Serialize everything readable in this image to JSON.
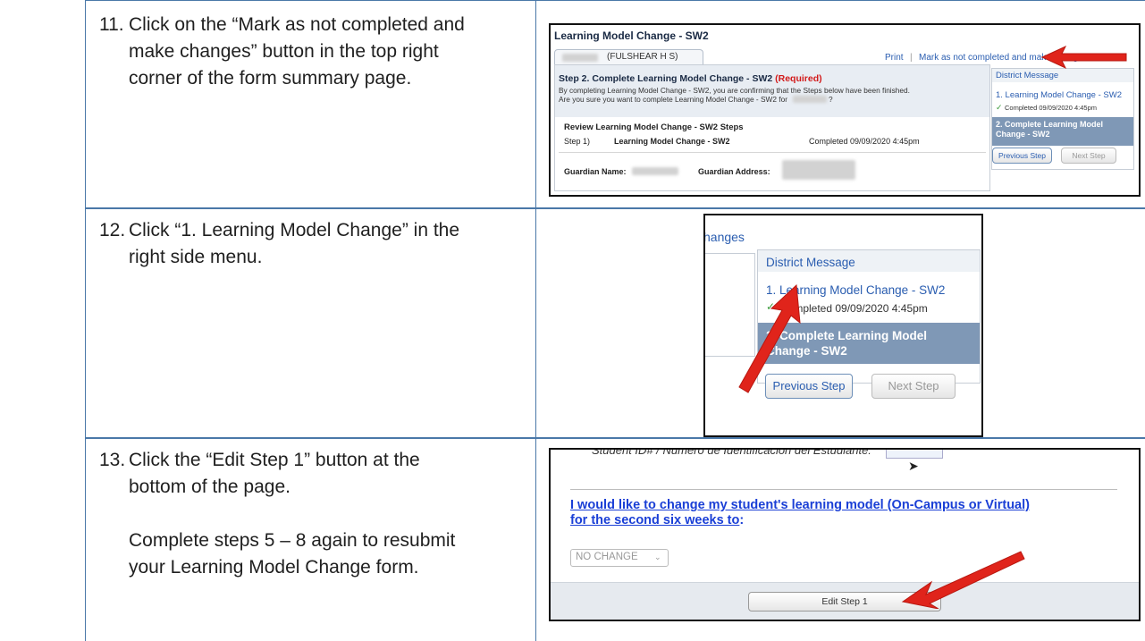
{
  "steps": [
    {
      "number": "11.",
      "text": "Click on the “Mark as not completed and\nmake changes” button in the top right\ncorner of the form summary page."
    },
    {
      "number": "12.",
      "text": "Click “1. Learning Model Change” in the\nright side menu."
    },
    {
      "number": "13.",
      "text": "Click the “Edit Step 1” button at the\nbottom of the page.",
      "extra": "Complete steps 5 – 8 again to resubmit\nyour Learning Model Change form."
    }
  ],
  "shot1": {
    "form_title": "Learning Model Change - SW2",
    "school_tab": "(FULSHEAR H S)",
    "print_link": "Print",
    "separator": "|",
    "mark_link": "Mark as not completed and make changes",
    "step_heading": "Step 2. Complete Learning Model Change - SW2",
    "required": "(Required)",
    "confirm_line1": "By completing Learning Model Change - SW2, you are confirming that the Steps below have been finished.",
    "confirm_line2": "Are you sure you want to complete Learning Model Change - SW2 for",
    "confirm_q": "?",
    "review_heading": "Review Learning Model Change - SW2 Steps",
    "step1_label": "Step 1)",
    "step1_name": "Learning Model Change - SW2",
    "step1_status": "Completed 09/09/2020 4:45pm",
    "guardian_name_label": "Guardian Name:",
    "guardian_address_label": "Guardian Address:",
    "sidebar_header": "District Message",
    "sidebar_item1": "1. Learning Model Change - SW2",
    "sidebar_item1_status": "Completed 09/09/2020 4:45pm",
    "sidebar_item2": "2. Complete Learning Model Change - SW2",
    "prev_button": "Previous Step",
    "next_button": "Next Step"
  },
  "shot2": {
    "partial_text": "hanges",
    "sidebar_header": "District Message",
    "item1": "1. Learning Model Change - SW2",
    "item1_status": "Completed 09/09/2020 4:45pm",
    "item2_line1": "2. Complete Learning Model",
    "item2_line2": "Change - SW2",
    "prev_button": "Previous Step",
    "next_button": "Next Step"
  },
  "shot3": {
    "cut_text": "Student ID# / Numero de Identificacion del Estudiante:",
    "question_line1": "I would like to change my student's learning model (On-Campus or Virtual)",
    "question_line2": "for the second six weeks to",
    "question_colon": ":",
    "select_value": "NO CHANGE",
    "edit_button": "Edit Step 1"
  },
  "colors": {
    "table_border": "#4a78a8",
    "link": "#2a5db0",
    "required": "#d21a1a",
    "arrow": "#e0241b",
    "sidebar_selected": "#7f98b6"
  }
}
